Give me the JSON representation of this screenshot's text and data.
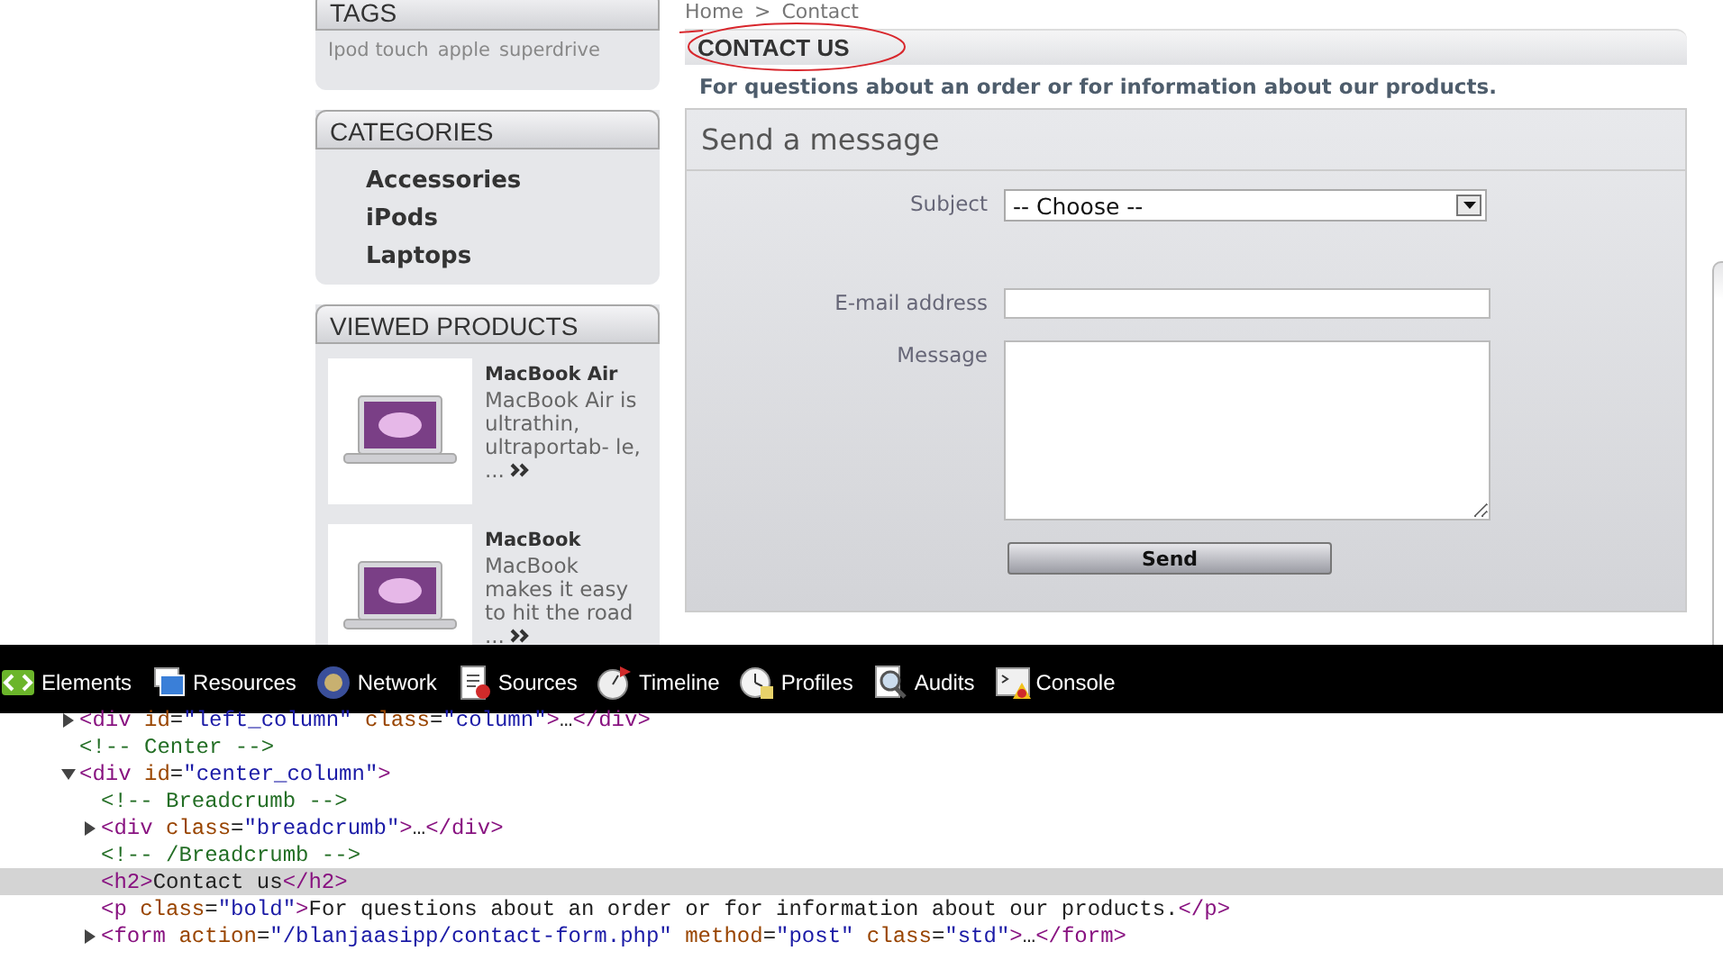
{
  "sidebar": [
    {
      "kind": "tags",
      "title": "TAGS",
      "items": [
        "Ipod touch",
        "apple",
        "superdrive"
      ]
    },
    {
      "kind": "links",
      "title": "CATEGORIES",
      "items": [
        "Accessories",
        "iPods",
        "Laptops"
      ]
    },
    {
      "kind": "products",
      "title": "VIEWED PRODUCTS",
      "items": [
        {
          "name": "MacBook Air",
          "description": "MacBook Air is ultrathin, ultraportab- le, ..."
        },
        {
          "name": "MacBook",
          "description": "MacBook makes it easy to hit the road ..."
        }
      ]
    }
  ],
  "breadcrumb": {
    "items": [
      "Home",
      "Contact"
    ],
    "separator": ">"
  },
  "page_title": "CONTACT US",
  "intro": "For questions about an order or for information about our products.",
  "form": {
    "title": "Send a message",
    "fields": [
      {
        "kind": "select",
        "label": "Subject",
        "value": "-- Choose --"
      },
      {
        "kind": "input",
        "label": "E-mail address"
      },
      {
        "kind": "textarea",
        "label": "Message"
      }
    ],
    "submit": "Send"
  },
  "devtools": {
    "tabs": [
      "Elements",
      "Resources",
      "Network",
      "Sources",
      "Timeline",
      "Profiles",
      "Audits",
      "Console"
    ],
    "dom_tree": [
      {
        "expandable": true,
        "expanded": false,
        "selected": false,
        "tokens": [
          {
            "kind": "tag",
            "text": "<div"
          },
          {
            "kind": "attr",
            "text": " id"
          },
          {
            "kind": "text",
            "text": "="
          },
          {
            "kind": "value",
            "text": "\"left_column\""
          },
          {
            "kind": "attr",
            "text": " class"
          },
          {
            "kind": "text",
            "text": "="
          },
          {
            "kind": "value",
            "text": "\"column\""
          },
          {
            "kind": "tag",
            "text": ">"
          },
          {
            "kind": "text",
            "text": "…"
          },
          {
            "kind": "tag",
            "text": "</div>"
          }
        ]
      },
      {
        "expandable": false,
        "selected": false,
        "tokens": [
          {
            "kind": "comment",
            "text": "<!-- Center -->"
          }
        ]
      },
      {
        "expandable": true,
        "expanded": true,
        "selected": false,
        "tokens": [
          {
            "kind": "tag",
            "text": "<div"
          },
          {
            "kind": "attr",
            "text": " id"
          },
          {
            "kind": "text",
            "text": "="
          },
          {
            "kind": "value",
            "text": "\"center_column\""
          },
          {
            "kind": "tag",
            "text": ">"
          }
        ],
        "children": [
          {
            "expandable": false,
            "selected": false,
            "tokens": [
              {
                "kind": "comment",
                "text": "<!-- Breadcrumb -->"
              }
            ]
          },
          {
            "expandable": true,
            "expanded": false,
            "selected": false,
            "tokens": [
              {
                "kind": "tag",
                "text": "<div"
              },
              {
                "kind": "attr",
                "text": " class"
              },
              {
                "kind": "text",
                "text": "="
              },
              {
                "kind": "value",
                "text": "\"breadcrumb\""
              },
              {
                "kind": "tag",
                "text": ">"
              },
              {
                "kind": "text",
                "text": "…"
              },
              {
                "kind": "tag",
                "text": "</div>"
              }
            ]
          },
          {
            "expandable": false,
            "selected": false,
            "tokens": [
              {
                "kind": "comment",
                "text": "<!-- /Breadcrumb -->"
              }
            ]
          },
          {
            "expandable": false,
            "selected": true,
            "tokens": [
              {
                "kind": "tag",
                "text": "<h2>"
              },
              {
                "kind": "text",
                "text": "Contact us"
              },
              {
                "kind": "tag",
                "text": "</h2>"
              }
            ]
          },
          {
            "expandable": false,
            "selected": false,
            "tokens": [
              {
                "kind": "tag",
                "text": "<p"
              },
              {
                "kind": "attr",
                "text": " class"
              },
              {
                "kind": "text",
                "text": "="
              },
              {
                "kind": "value",
                "text": "\"bold\""
              },
              {
                "kind": "tag",
                "text": ">"
              },
              {
                "kind": "text",
                "text": "For questions about an order or for information about our products."
              },
              {
                "kind": "tag",
                "text": "</p>"
              }
            ]
          },
          {
            "expandable": true,
            "expanded": false,
            "selected": false,
            "tokens": [
              {
                "kind": "tag",
                "text": "<form"
              },
              {
                "kind": "attr",
                "text": " action"
              },
              {
                "kind": "text",
                "text": "="
              },
              {
                "kind": "value",
                "text": "\"/blanjaasipp/contact-form.php\""
              },
              {
                "kind": "attr",
                "text": " method"
              },
              {
                "kind": "text",
                "text": "="
              },
              {
                "kind": "value",
                "text": "\"post\""
              },
              {
                "kind": "attr",
                "text": " class"
              },
              {
                "kind": "text",
                "text": "="
              },
              {
                "kind": "value",
                "text": "\"std\""
              },
              {
                "kind": "tag",
                "text": ">"
              },
              {
                "kind": "text",
                "text": "…"
              },
              {
                "kind": "tag",
                "text": "</form>"
              }
            ]
          }
        ]
      }
    ]
  }
}
